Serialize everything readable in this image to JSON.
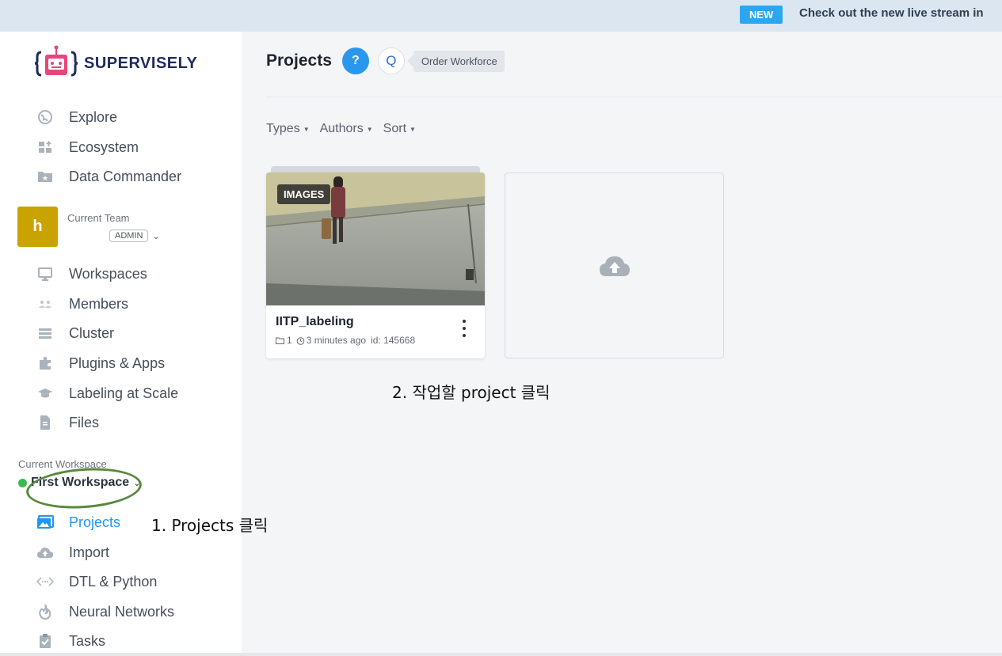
{
  "banner": {
    "badge": "NEW",
    "message": "Check out the new live stream in"
  },
  "brand": {
    "name": "SUPERVISELY"
  },
  "nav_top": [
    {
      "label": "Explore",
      "icon": "globe-icon"
    },
    {
      "label": "Ecosystem",
      "icon": "ecosystem-icon"
    },
    {
      "label": "Data Commander",
      "icon": "folder-star-icon"
    }
  ],
  "team": {
    "avatar_letter": "h",
    "caption": "Current Team",
    "role": "ADMIN"
  },
  "nav_team": [
    {
      "label": "Workspaces",
      "icon": "monitor-icon"
    },
    {
      "label": "Members",
      "icon": "members-icon"
    },
    {
      "label": "Cluster",
      "icon": "cluster-icon"
    },
    {
      "label": "Plugins & Apps",
      "icon": "puzzle-icon"
    },
    {
      "label": "Labeling at Scale",
      "icon": "graduation-cap-icon"
    },
    {
      "label": "Files",
      "icon": "file-icon"
    }
  ],
  "workspace": {
    "caption": "Current Workspace",
    "name": "First Workspace"
  },
  "nav_workspace": [
    {
      "label": "Projects",
      "icon": "image-icon",
      "active": true
    },
    {
      "label": "Import",
      "icon": "cloud-upload-icon"
    },
    {
      "label": "DTL & Python",
      "icon": "code-icon"
    },
    {
      "label": "Neural Networks",
      "icon": "flame-icon"
    },
    {
      "label": "Tasks",
      "icon": "clipboard-check-icon"
    }
  ],
  "header": {
    "title": "Projects",
    "help_label": "?",
    "search_label": "Q",
    "tag_label": "Order Workforce"
  },
  "filters": [
    "Types",
    "Authors",
    "Sort"
  ],
  "project_card": {
    "type_badge": "IMAGES",
    "name": "IITP_labeling",
    "datasets_count": "1",
    "updated": "3 minutes ago",
    "id_text": "id: 145668"
  },
  "annotations": {
    "step1": "1. Projects 클릭",
    "step2": "2. 작업할 project 클릭"
  },
  "colors": {
    "accent": "#2196f3",
    "team_avatar": "#c9a300",
    "annotation_outline": "#58893d",
    "workspace_dot": "#3dba4e"
  }
}
